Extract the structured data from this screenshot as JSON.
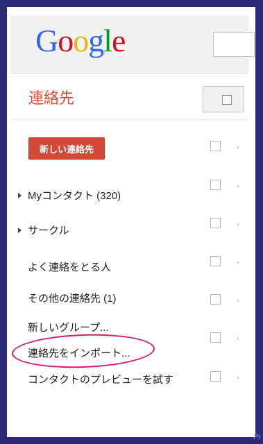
{
  "header": {
    "logo_text": "Google",
    "logo_colors": [
      "#3369e8",
      "#d50f25",
      "#eeb211",
      "#3369e8",
      "#009925",
      "#d50f25"
    ]
  },
  "app": {
    "title": "連絡先",
    "accent_color": "#dd4b39"
  },
  "actions": {
    "new_contact_label": "新しい連絡先"
  },
  "sidebar": {
    "items": [
      {
        "label": "Myコンタクト (320)",
        "has_arrow": true
      },
      {
        "label": "サークル",
        "has_arrow": true
      },
      {
        "label": "よく連絡をとる人",
        "has_arrow": false
      },
      {
        "label": "その他の連絡先 (1)",
        "has_arrow": false
      },
      {
        "label": "新しいグループ...",
        "has_arrow": false
      },
      {
        "label": "連絡先をインポート...",
        "has_arrow": false
      },
      {
        "label": "コンタクトのプレビューを試す",
        "has_arrow": false
      }
    ]
  },
  "annotation": {
    "highlight_color": "#d6166f",
    "highlighted_item": "連絡先をインポート..."
  },
  "watermark": "Pi"
}
